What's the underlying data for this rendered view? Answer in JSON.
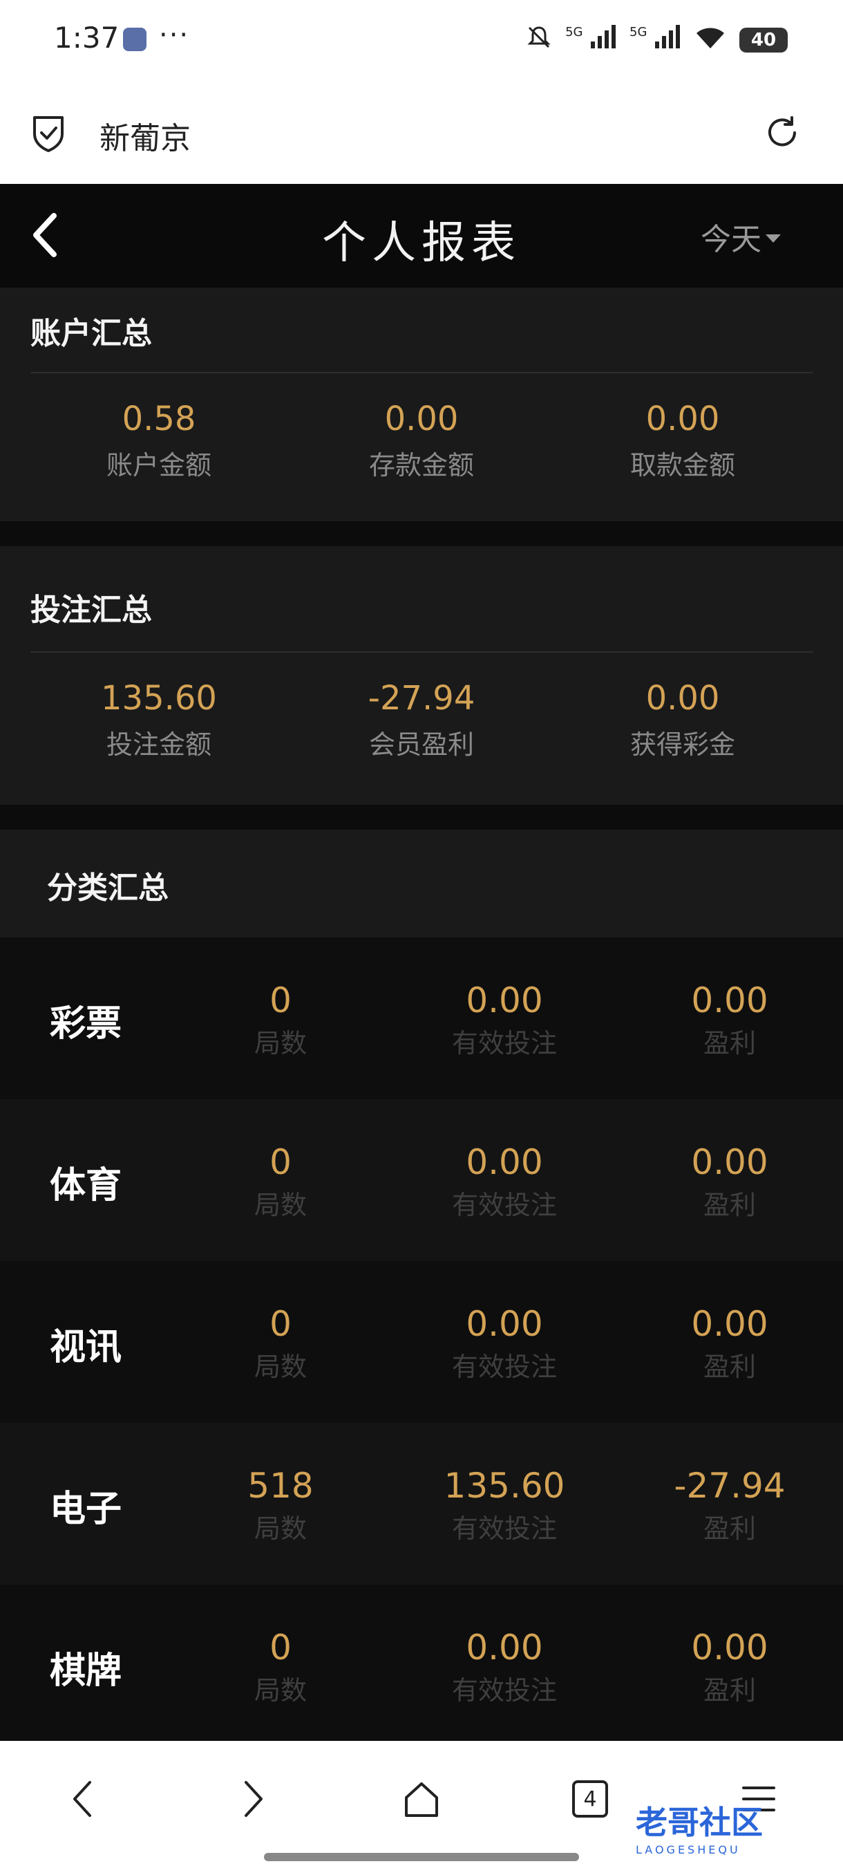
{
  "status_bar": {
    "time": "1:37",
    "dots": "···",
    "signal_1": "5G",
    "signal_2": "5G",
    "battery": "40"
  },
  "browser": {
    "site_title": "新葡京",
    "tab_count": "4"
  },
  "header": {
    "title": "个人报表",
    "date_filter": "今天"
  },
  "account_summary": {
    "title": "账户汇总",
    "stats": [
      {
        "value": "0.58",
        "label": "账户金额"
      },
      {
        "value": "0.00",
        "label": "存款金额"
      },
      {
        "value": "0.00",
        "label": "取款金额"
      }
    ]
  },
  "bet_summary": {
    "title": "投注汇总",
    "stats": [
      {
        "value": "135.60",
        "label": "投注金额"
      },
      {
        "value": "-27.94",
        "label": "会员盈利"
      },
      {
        "value": "0.00",
        "label": "获得彩金"
      }
    ]
  },
  "category_summary": {
    "title": "分类汇总",
    "col_labels": [
      "局数",
      "有效投注",
      "盈利"
    ],
    "rows": [
      {
        "name": "彩票",
        "rounds": "0",
        "valid_bet": "0.00",
        "profit": "0.00"
      },
      {
        "name": "体育",
        "rounds": "0",
        "valid_bet": "0.00",
        "profit": "0.00"
      },
      {
        "name": "视讯",
        "rounds": "0",
        "valid_bet": "0.00",
        "profit": "0.00"
      },
      {
        "name": "电子",
        "rounds": "518",
        "valid_bet": "135.60",
        "profit": "-27.94"
      },
      {
        "name": "棋牌",
        "rounds": "0",
        "valid_bet": "0.00",
        "profit": "0.00"
      }
    ]
  },
  "watermark": {
    "text": "老哥社区",
    "sub": "LAOGESHEQU"
  },
  "colors": {
    "accent_gold": "#d4a355",
    "background": "#0c0c0c",
    "card": "#1a1a1a"
  }
}
